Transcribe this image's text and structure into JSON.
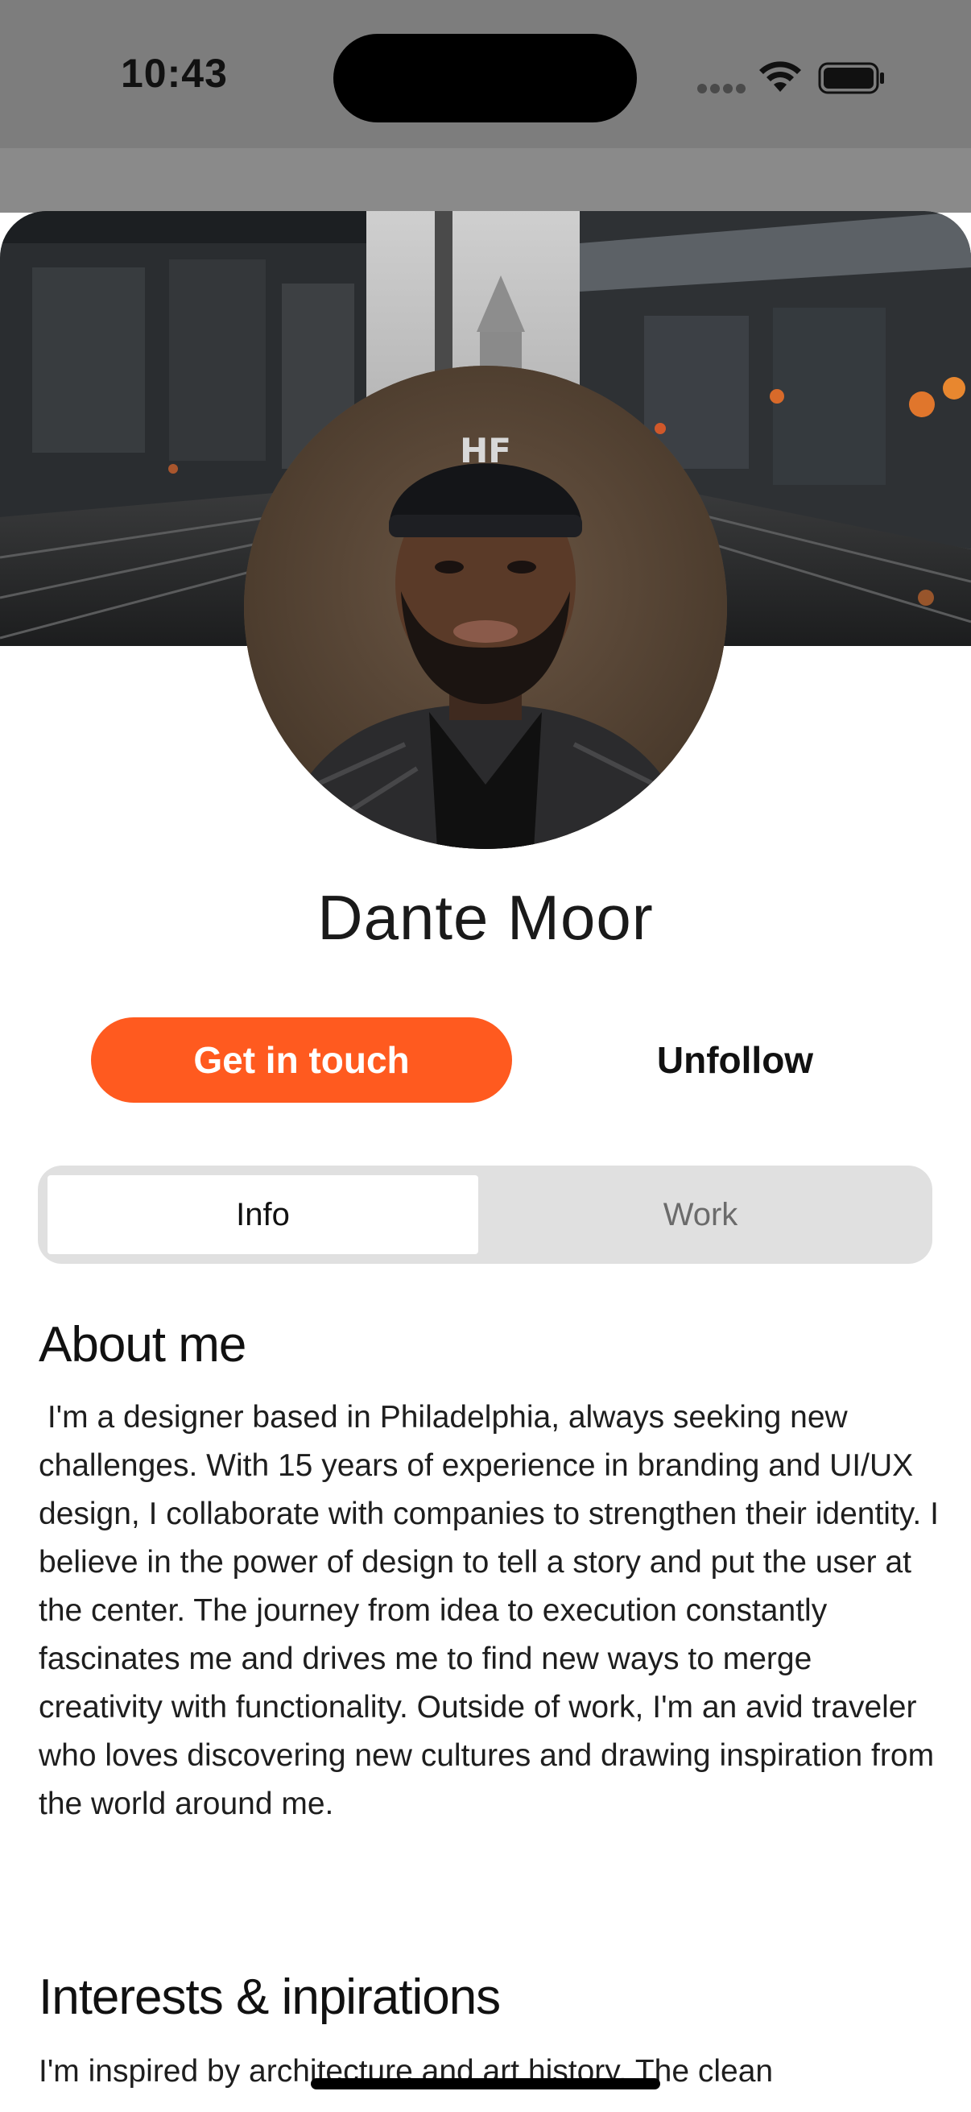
{
  "status_bar": {
    "time": "10:43"
  },
  "profile": {
    "name": "Dante Moor"
  },
  "actions": {
    "primary_label": "Get in touch",
    "secondary_label": "Unfollow"
  },
  "tabs": [
    {
      "label": "Info",
      "selected": true
    },
    {
      "label": "Work",
      "selected": false
    }
  ],
  "sections": {
    "about": {
      "title": "About me",
      "body": " I'm a designer based in Philadelphia, always seeking new challenges. With 15 years of experience in branding and UI/UX design, I collaborate with companies to strengthen their identity. I believe in the power of design to tell a story and put the user at the center. The journey from idea to execution constantly fascinates me and drives me to find new ways to merge creativity with functionality. Outside of work, I'm an avid traveler who loves discovering new cultures and drawing inspiration from the world around me."
    },
    "interests": {
      "title": "Interests & inpirations",
      "body": "I'm inspired by architecture and art history. The clean"
    }
  },
  "colors": {
    "accent": "#ff5a1f",
    "segment_bg": "#e0e0e0",
    "dim_overlay": "#7d7d7d"
  },
  "icons": [
    "cellular-signal-icon",
    "wifi-icon",
    "battery-icon"
  ]
}
